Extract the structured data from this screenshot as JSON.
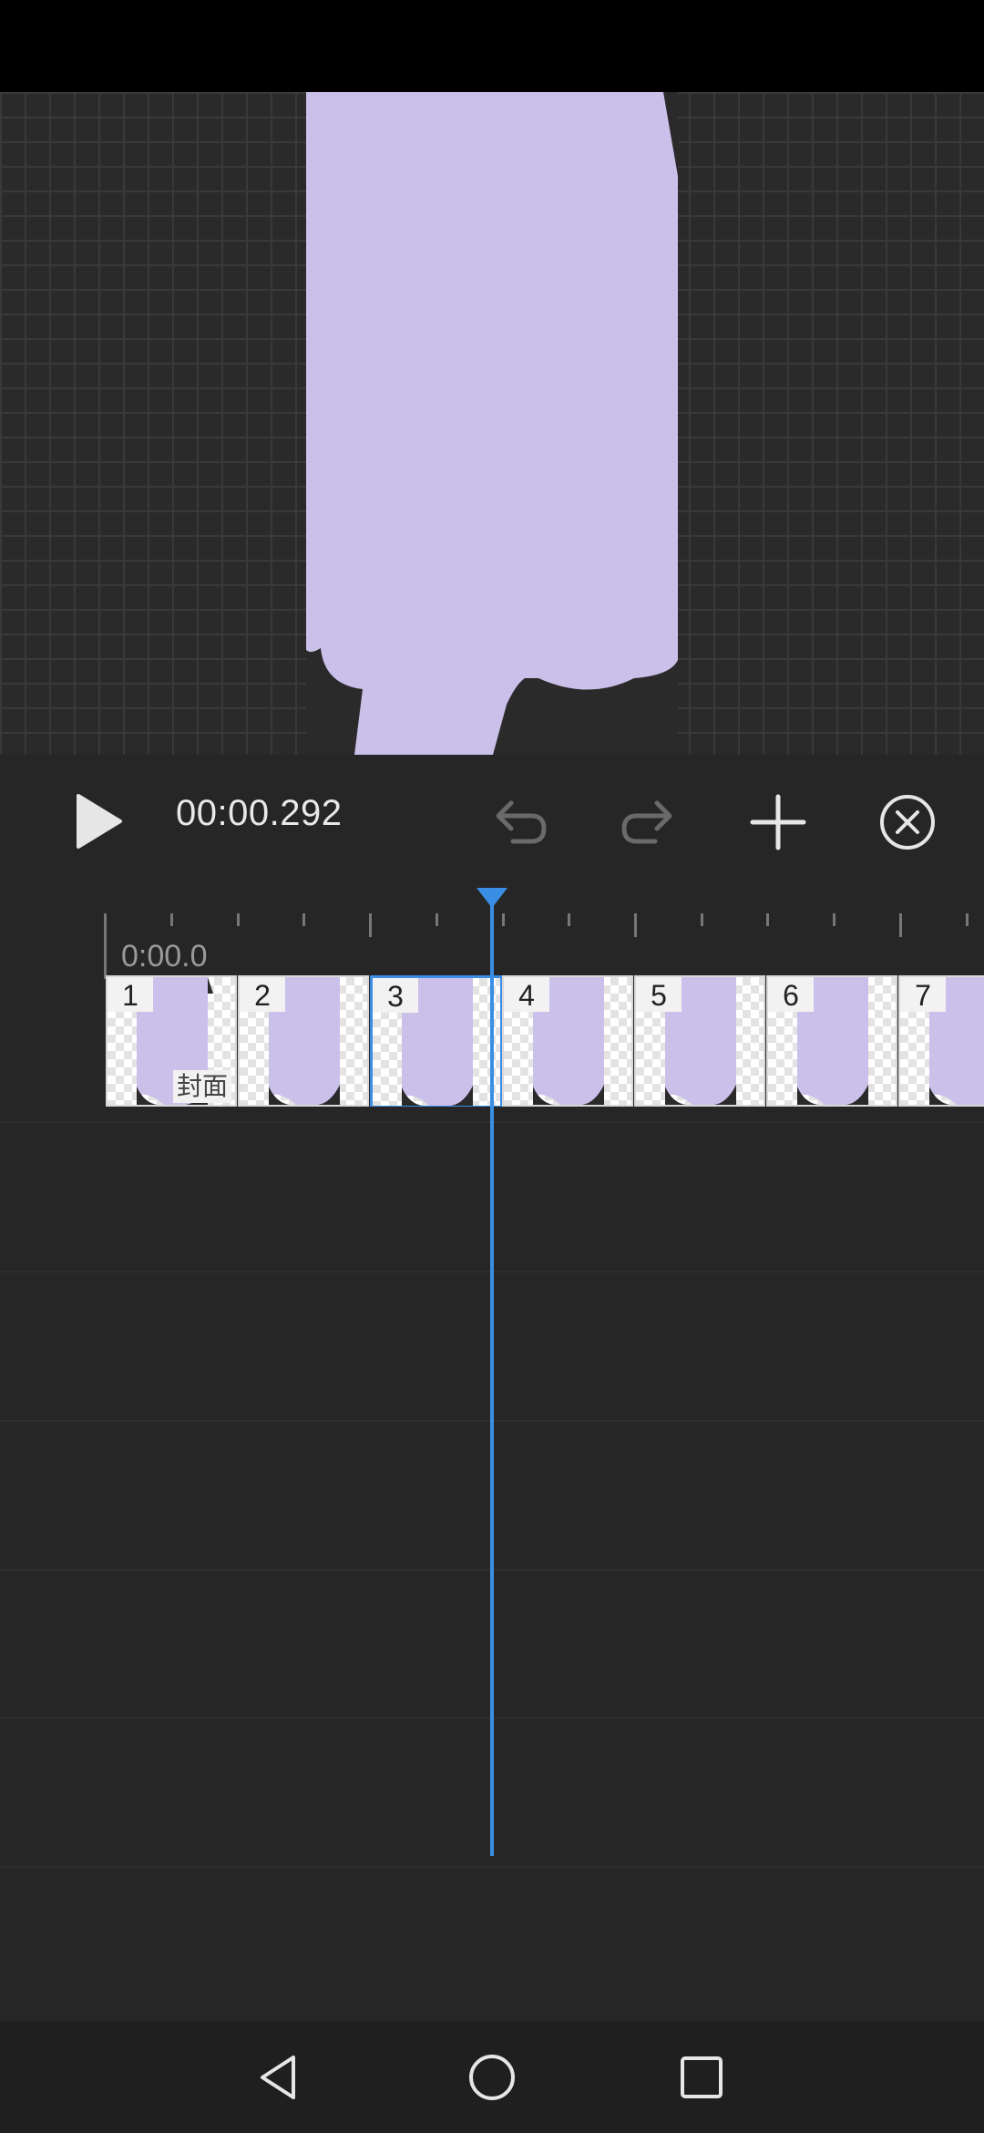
{
  "toolbar": {
    "play": "play-icon",
    "time": "00:00.292",
    "undo": "undo-icon",
    "redo": "redo-icon",
    "add": "plus-icon",
    "close": "close-circle-icon"
  },
  "timeline": {
    "start_label": "0:00.0",
    "frames": [
      {
        "number": "1"
      },
      {
        "number": "2"
      },
      {
        "number": "3"
      },
      {
        "number": "4"
      },
      {
        "number": "5"
      },
      {
        "number": "6"
      },
      {
        "number": "7"
      }
    ],
    "selected_frame": 3,
    "cover_label": "封面"
  },
  "colors": {
    "accent": "#3a8ee6",
    "shape": "#cbc0ea",
    "background": "#262626"
  },
  "nav": {
    "back": "back-triangle-icon",
    "home": "home-circle-icon",
    "recents": "recents-square-icon"
  }
}
